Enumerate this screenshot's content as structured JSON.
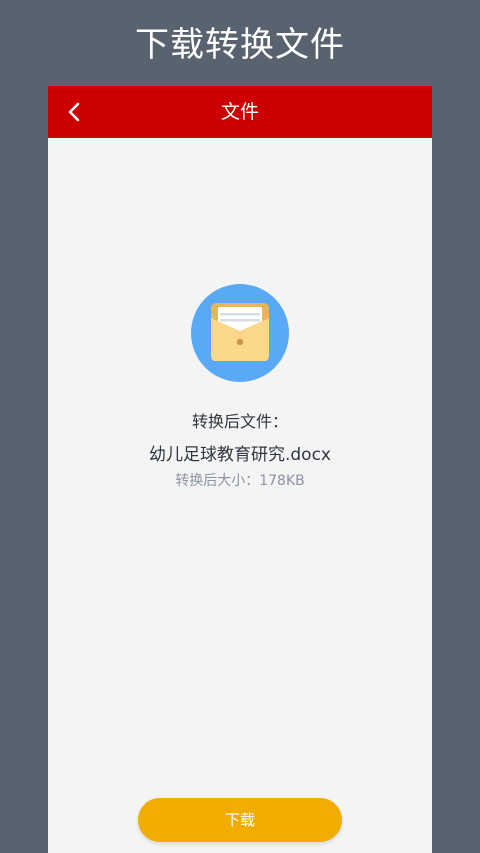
{
  "promo": {
    "title": "下载转换文件"
  },
  "nav": {
    "title": "文件",
    "back_icon": "chevron-left-icon"
  },
  "file": {
    "icon": "folder-document-icon",
    "converted_label": "转换后文件：",
    "name": "幼儿足球教育研究.docx",
    "size_label": "转换后大小：178KB"
  },
  "actions": {
    "download_label": "下载"
  },
  "colors": {
    "background": "#59636f",
    "nav_bar": "#cc0000",
    "content_bg": "#f4f4f4",
    "icon_circle": "#5aa9f7",
    "download_button": "#f0ad00"
  }
}
